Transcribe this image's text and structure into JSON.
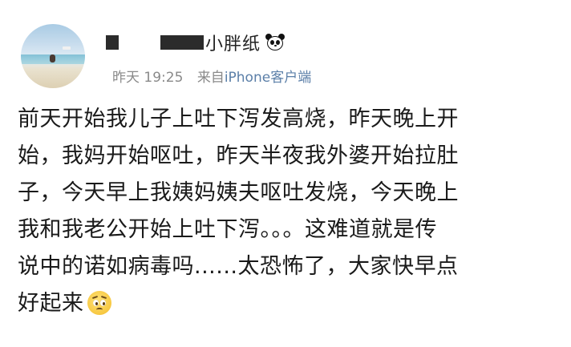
{
  "post": {
    "username_visible": "小胖纸",
    "timestamp": "昨天 19:25",
    "source_prefix": "来自",
    "source_device": "iPhone客户端",
    "content_lines": [
      "前天开始我儿子上吐下泻发高烧，昨天晚上开",
      "始，我妈开始呕吐，昨天半夜我外婆开始拉肚",
      "子，今天早上我姨妈姨夫呕吐发烧，今天晚上",
      "我和我老公开始上吐下泻。。。这难道就是传",
      "说中的诺如病毒吗......太恐怖了，大家快早点",
      "好起来"
    ],
    "icons": {
      "username_badge": "panda-icon",
      "content_end_emoji": "pleading-face-emoji-icon"
    }
  }
}
